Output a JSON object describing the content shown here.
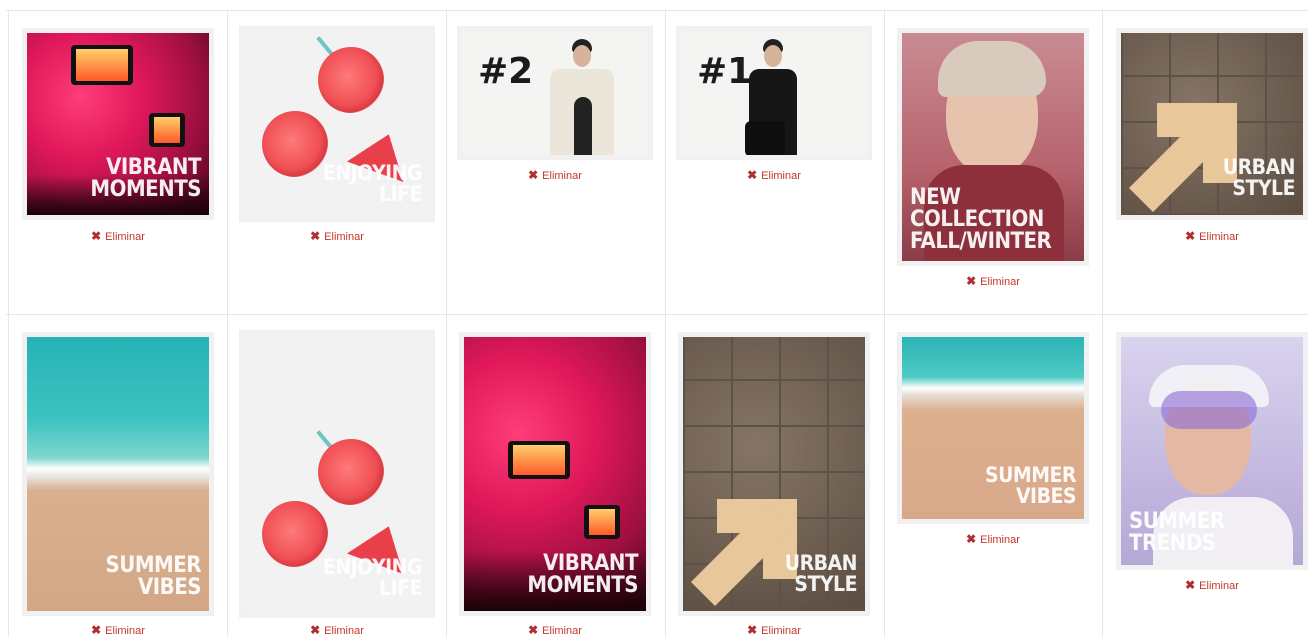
{
  "remove_label": "Eliminar",
  "remove_icon": "close-icon",
  "accent_color": "#c0392b",
  "items": [
    {
      "title_line1": "VIBRANT",
      "title_line2": "MOMENTS"
    },
    {
      "title_line1": "ENJOYING",
      "title_line2": "LIFE"
    },
    {
      "rank": "#2"
    },
    {
      "rank": "#1"
    },
    {
      "title_line1": "NEW COLLECTION",
      "title_line2": "FALL/WINTER"
    },
    {
      "title_line1": "URBAN",
      "title_line2": "STYLE"
    },
    {
      "title_line1": "SUMMER",
      "title_line2": "VIBES"
    },
    {
      "title_line1": "ENJOYING",
      "title_line2": "LIFE"
    },
    {
      "title_line1": "VIBRANT",
      "title_line2": "MOMENTS"
    },
    {
      "title_line1": "URBAN",
      "title_line2": "STYLE"
    },
    {
      "title_line1": "SUMMER",
      "title_line2": "VIBES"
    },
    {
      "title_line1": "SUMMER",
      "title_line2": "TRENDS"
    }
  ]
}
